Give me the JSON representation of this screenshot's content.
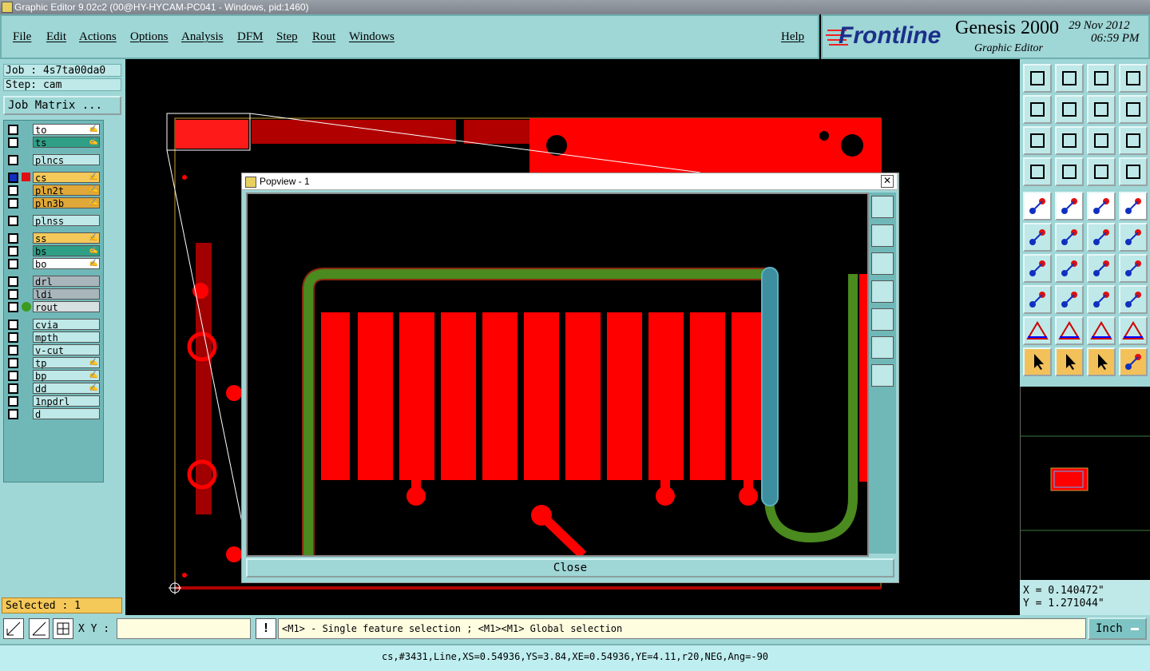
{
  "window": {
    "title": "Graphic Editor 9.02c2 (00@HY-HYCAM-PC041 - Windows, pid:1460)"
  },
  "menu": [
    "File",
    "Edit",
    "Actions",
    "Options",
    "Analysis",
    "DFM",
    "Step",
    "Rout",
    "Windows"
  ],
  "help": "Help",
  "brand": {
    "logo": "Frontline",
    "product": "Genesis 2000",
    "subtitle": "Graphic Editor",
    "date": "29 Nov 2012",
    "time": "06:59 PM"
  },
  "job": {
    "label": "Job : 4s7ta00da0",
    "step": "Step: cam",
    "matrix_button": "Job Matrix ..."
  },
  "layers": [
    {
      "name": "to",
      "color": "#ffffff",
      "editable": true
    },
    {
      "name": "ts",
      "color": "#2f9f86",
      "editable": true
    },
    {
      "name": "plncs",
      "color": "#bfe8e8",
      "editable": false
    },
    {
      "name": "cs",
      "color": "#f5c85a",
      "editable": true,
      "active": true
    },
    {
      "name": "pln2t",
      "color": "#e0a838",
      "editable": true
    },
    {
      "name": "pln3b",
      "color": "#e0a838",
      "editable": true
    },
    {
      "name": "plnss",
      "color": "#bfe8e8",
      "editable": false
    },
    {
      "name": "ss",
      "color": "#f5c85a",
      "editable": true
    },
    {
      "name": "bs",
      "color": "#2f9f86",
      "editable": true
    },
    {
      "name": "bo",
      "color": "#ffffff",
      "editable": true
    },
    {
      "name": "drl",
      "color": "#a8b6bc",
      "editable": false
    },
    {
      "name": "ldi",
      "color": "#a8b6bc",
      "editable": false
    },
    {
      "name": "rout",
      "color": "#d6e0e0",
      "editable": false,
      "marker": "green"
    },
    {
      "name": "cvia",
      "color": "#bfe8e8",
      "editable": false
    },
    {
      "name": "mpth",
      "color": "#bfe8e8",
      "editable": false
    },
    {
      "name": "v-cut",
      "color": "#bfe8e8",
      "editable": false
    },
    {
      "name": "tp",
      "color": "#bfe8e8",
      "editable": true
    },
    {
      "name": "bp",
      "color": "#bfe8e8",
      "editable": true
    },
    {
      "name": "dd",
      "color": "#bfe8e8",
      "editable": true
    },
    {
      "name": "1npdrl",
      "color": "#bfe8e8",
      "editable": false
    },
    {
      "name": "d",
      "color": "#bfe8e8",
      "editable": false
    }
  ],
  "selected": "Selected : 1",
  "popview": {
    "title": "Popview - 1",
    "close": "Close"
  },
  "coords": {
    "x": "X = 0.140472\"",
    "y": "Y = 1.271044\""
  },
  "xy_label": "X Y :",
  "xy_value": "",
  "excl": "!",
  "hint": "<M1> - Single feature selection ; <M1><M1> Global selection",
  "unit": "Inch",
  "status": "cs,#3431,Line,XS=0.54936,YS=3.84,XE=0.54936,YE=4.11,r20,NEG,Ang=-90",
  "colors": {
    "copper": "#ff0000",
    "panel": "#9fd6d6",
    "rout": "#4a8a1e",
    "selected": "#3d8fa0"
  }
}
